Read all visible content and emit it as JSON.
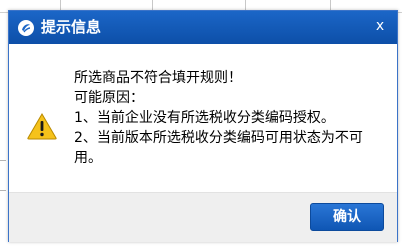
{
  "dialog": {
    "title": "提示信息",
    "close_glyph": "x",
    "icon_title": "app-logo-icon",
    "icon_message": "warning-icon",
    "message_lines": [
      "所选商品不符合填开规则！",
      "可能原因：",
      "1、当前企业没有所选税收分类编码授权。",
      "2、当前版本所选税收分类编码可用状态为不可",
      "用。"
    ],
    "ok_label": "确认"
  },
  "colors": {
    "titlebar": "#0f56b4",
    "button": "#1460c2",
    "footer": "#efefef",
    "warning": "#f5c21b"
  }
}
